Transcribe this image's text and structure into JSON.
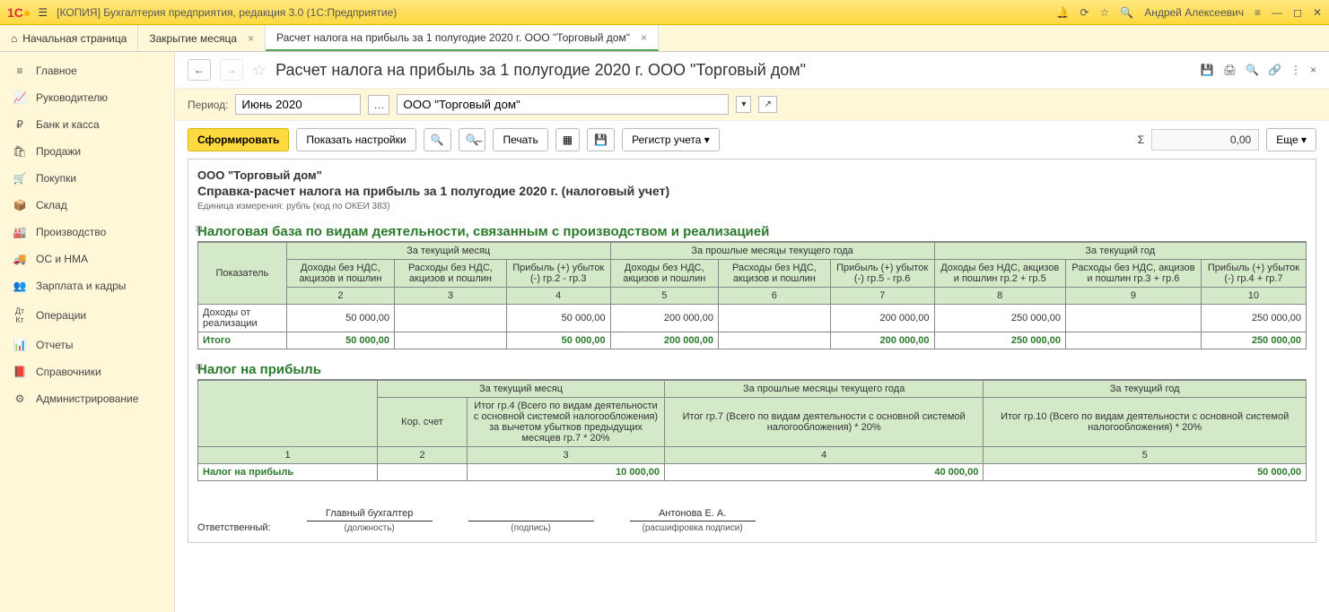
{
  "titlebar": {
    "app_title": "[КОПИЯ] Бухгалтерия предприятия, редакция 3.0  (1С:Предприятие)",
    "user": "Андрей Алексеевич"
  },
  "tabs": {
    "home": "Начальная страница",
    "t1": "Закрытие месяца",
    "t2": "Расчет налога на прибыль за 1 полугодие 2020 г. ООО \"Торговый дом\""
  },
  "sidebar": {
    "items": [
      {
        "icon": "≡",
        "label": "Главное"
      },
      {
        "icon": "📈",
        "label": "Руководителю"
      },
      {
        "icon": "₽",
        "label": "Банк и касса"
      },
      {
        "icon": "🛍",
        "label": "Продажи"
      },
      {
        "icon": "🛒",
        "label": "Покупки"
      },
      {
        "icon": "📦",
        "label": "Склад"
      },
      {
        "icon": "🏭",
        "label": "Производство"
      },
      {
        "icon": "🚚",
        "label": "ОС и НМА"
      },
      {
        "icon": "👥",
        "label": "Зарплата и кадры"
      },
      {
        "icon": "Дт/Кт",
        "label": "Операции"
      },
      {
        "icon": "📊",
        "label": "Отчеты"
      },
      {
        "icon": "📕",
        "label": "Справочники"
      },
      {
        "icon": "⚙",
        "label": "Администрирование"
      }
    ]
  },
  "page": {
    "title": "Расчет налога на прибыль за 1 полугодие 2020 г. ООО \"Торговый дом\"",
    "period_label": "Период:",
    "period_value": "Июнь 2020",
    "org_value": "ООО \"Торговый дом\""
  },
  "toolbar": {
    "form": "Сформировать",
    "show_settings": "Показать настройки",
    "print": "Печать",
    "register": "Регистр учета",
    "sigma_val": "0,00",
    "more": "Еще"
  },
  "report": {
    "org": "ООО \"Торговый дом\"",
    "title": "Справка-расчет налога на прибыль за 1 полугодие 2020 г. (налоговый учет)",
    "unit": "Единица измерения:  рубль (код по ОКЕИ 383)",
    "sect1": {
      "title": "Налоговая база по видам деятельности, связанным с производством и реализацией",
      "h_indicator": "Показатель",
      "h_cur_month": "За текущий месяц",
      "h_past_months": "За прошлые месяцы текущего года",
      "h_cur_year": "За текущий год",
      "sub": [
        "Доходы без НДС, акцизов и пошлин",
        "Расходы без НДС, акцизов и пошлин",
        "Прибыль (+) убыток (-) гр.2 - гр.3",
        "Доходы без НДС, акцизов и пошлин",
        "Расходы без НДС, акцизов и пошлин",
        "Прибыль (+) убыток (-) гр.5 - гр.6",
        "Доходы без НДС, акцизов и пошлин гр.2 + гр.5",
        "Расходы без НДС, акцизов и пошлин гр.3 + гр.6",
        "Прибыль (+) убыток (-) гр.4 + гр.7"
      ],
      "nums": [
        "2",
        "3",
        "4",
        "5",
        "6",
        "7",
        "8",
        "9",
        "10"
      ],
      "row1_lbl": "Доходы от реализации",
      "row1": [
        "50 000,00",
        "",
        "50 000,00",
        "200 000,00",
        "",
        "200 000,00",
        "250 000,00",
        "",
        "250 000,00"
      ],
      "total_lbl": "Итого",
      "total": [
        "50 000,00",
        "",
        "50 000,00",
        "200 000,00",
        "",
        "200 000,00",
        "250 000,00",
        "",
        "250 000,00"
      ]
    },
    "sect2": {
      "title": "Налог на прибыль",
      "h_cur_month": "За текущий месяц",
      "h_past_months": "За прошлые месяцы текущего года",
      "h_cur_year": "За текущий год",
      "sub_acc": "Кор. счет",
      "sub_m": "Итог гр.4 (Всего по видам деятельности с основной системой налогообложения) за вычетом убытков предыдущих месяцев гр.7 * 20%",
      "sub_p": "Итог гр.7 (Всего по видам деятельности с основной системой налогообложения) * 20%",
      "sub_y": "Итог гр.10 (Всего по видам деятельности с основной системой налогообложения) * 20%",
      "nums": [
        "1",
        "2",
        "3",
        "4",
        "5"
      ],
      "row_lbl": "Налог на прибыль",
      "row": [
        "",
        "",
        "10 000,00",
        "40 000,00",
        "50 000,00"
      ]
    },
    "footer": {
      "resp": "Ответственный:",
      "pos_val": "Главный бухгалтер",
      "pos_lbl": "(должность)",
      "sig_lbl": "(подпись)",
      "name_val": "Антонова Е. А.",
      "name_lbl": "(расшифровка подписи)"
    }
  }
}
